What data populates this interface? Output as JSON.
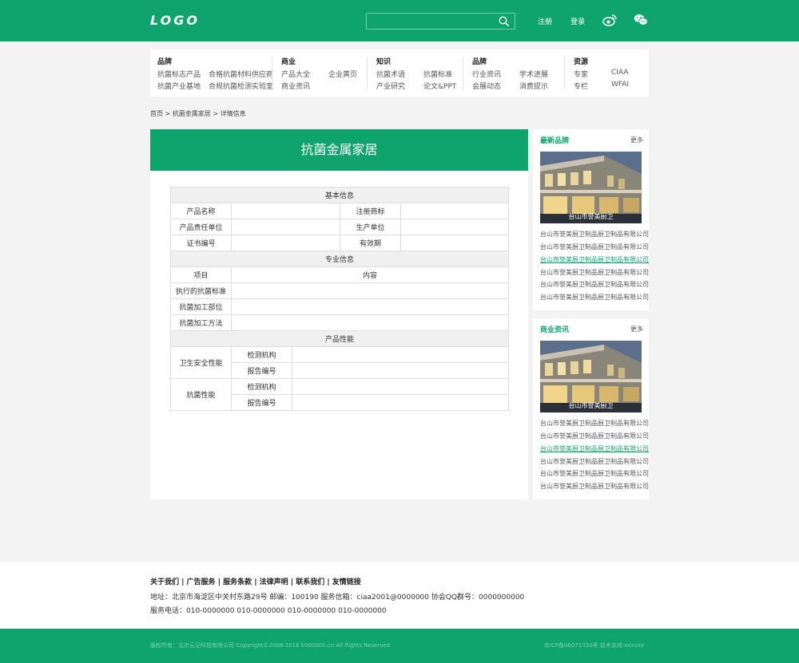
{
  "header": {
    "logo": "LOGO",
    "search_placeholder": "",
    "register": "注册",
    "login": "登录"
  },
  "nav": {
    "groups": [
      {
        "title": "品牌",
        "items": [
          "抗菌标志产品",
          "合格抗菌材料供应商",
          "抗菌产业基地",
          "合规抗菌检测实验室"
        ]
      },
      {
        "title": "商业",
        "items": [
          "产品大全",
          "企业黄页",
          "商业资讯"
        ]
      },
      {
        "title": "知识",
        "items": [
          "抗菌术语",
          "抗菌标准",
          "产业研究",
          "论文&PPT"
        ]
      },
      {
        "title": "品牌",
        "items": [
          "行业资讯",
          "学术进展",
          "会展动态",
          "消费提示"
        ]
      },
      {
        "title": "资源",
        "items": [
          "专家",
          "CIAA",
          "专栏",
          "WFAI"
        ]
      }
    ]
  },
  "breadcrumb": "首页 > 抗菌金属家居 > 详情信息",
  "main": {
    "title": "抗菌金属家居",
    "table": {
      "basic_header": "基本信息",
      "product_name": "产品名称",
      "trademark": "注册商标",
      "responsible": "产品责任单位",
      "manufacturer": "生产单位",
      "cert_no": "证书编号",
      "validity": "有效期",
      "pro_header": "专业信息",
      "item": "项目",
      "content": "内容",
      "standard": "执行的抗菌标准",
      "part": "抗菌加工部位",
      "method": "抗菌加工方法",
      "perf_header": "产品性能",
      "hygiene": "卫生安全性能",
      "antibacterial": "抗菌性能",
      "test_org": "检测机构",
      "report_no": "报告编号"
    }
  },
  "sidebar": [
    {
      "title": "最新品牌",
      "more": "更多",
      "image_caption": "台山市誉美厨卫",
      "links": [
        "台山市誉美厨卫制品厨卫制品有限公司",
        "台山市誉美厨卫制品厨卫制品有限公司",
        "台山市誉美厨卫制品厨卫制品有限公司",
        "台山市誉美厨卫制品厨卫制品有限公司",
        "台山市誉美厨卫制品厨卫制品有限公司",
        "台山市誉美厨卫制品厨卫制品有限公司"
      ]
    },
    {
      "title": "商业资讯",
      "more": "更多",
      "image_caption": "台山市誉美厨卫",
      "links": [
        "台山市誉美厨卫制品厨卫制品有限公司",
        "台山市誉美厨卫制品厨卫制品有限公司",
        "台山市誉美厨卫制品厨卫制品有限公司",
        "台山市誉美厨卫制品厨卫制品有限公司",
        "台山市誉美厨卫制品厨卫制品有限公司",
        "台山市誉美厨卫制品厨卫制品有限公司"
      ]
    }
  ],
  "footer": {
    "links": "关于我们 | 广告服务 | 服务条款 | 法律声明 | 联系我们 | 友情链接",
    "address": "地址：北京市海淀区中关村东路29号   邮编：100190   服务信箱：ciaa2001@0000000   协会QQ群号：0000000000",
    "phone": "服务电话：010-0000000   010-0000000   010-0000000   010-0000000",
    "copyright": "版权所有：北京云记科技有限公司  Copyright©2008-2016 k000000.cn All Rights Reserved",
    "icp": "京ICP备06071330号   技术支持:xxxxxx"
  },
  "colors": {
    "brand": "#0fa46e",
    "link_highlight": "#0fa46e"
  }
}
